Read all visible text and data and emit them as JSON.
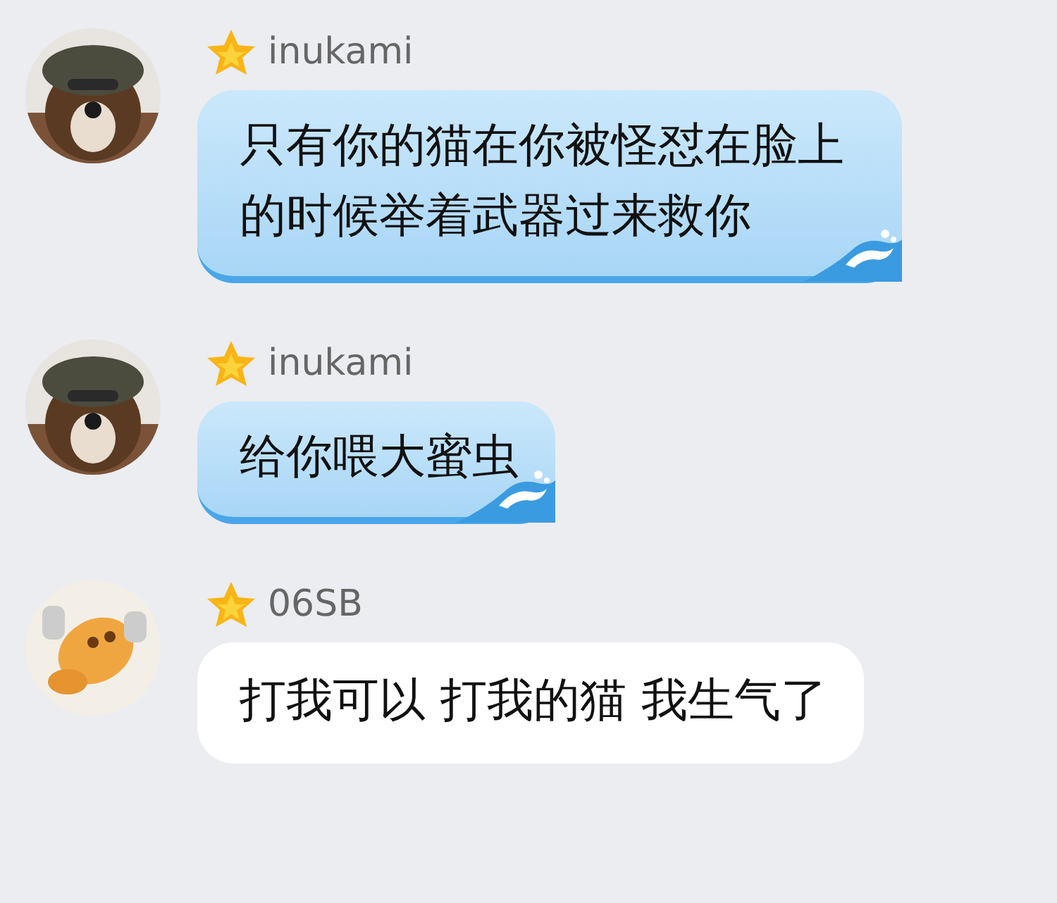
{
  "messages": [
    {
      "sender": "inukami",
      "text": "只有你的猫在你被怪怼在脸上的时候举着武器过来救你",
      "kind": "blue"
    },
    {
      "sender": "inukami",
      "text": "给你喂大蜜虫",
      "kind": "blue"
    },
    {
      "sender": "06SB",
      "text": "打我可以 打我的猫 我生气了",
      "kind": "white"
    }
  ]
}
